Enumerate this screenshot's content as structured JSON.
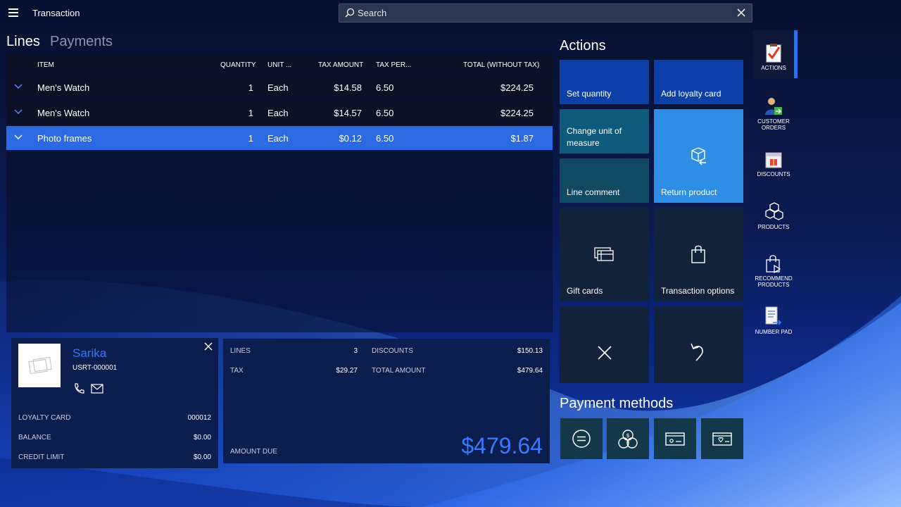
{
  "app": {
    "title": "Transaction"
  },
  "search": {
    "placeholder": "Search"
  },
  "tabs": [
    {
      "label": "Lines"
    },
    {
      "label": "Payments"
    }
  ],
  "grid": {
    "headers": {
      "item": "ITEM",
      "quantity": "QUANTITY",
      "unit": "UNIT ...",
      "tax_amount": "TAX AMOUNT",
      "tax_percent": "TAX PER...",
      "total": "TOTAL (WITHOUT TAX)"
    },
    "rows": [
      {
        "item": "Men's Watch",
        "quantity": "1",
        "unit": "Each",
        "tax_amount": "$14.58",
        "tax_percent": "6.50",
        "total": "$224.25"
      },
      {
        "item": "Men's Watch",
        "quantity": "1",
        "unit": "Each",
        "tax_amount": "$14.57",
        "tax_percent": "6.50",
        "total": "$224.25"
      },
      {
        "item": "Photo frames",
        "quantity": "1",
        "unit": "Each",
        "tax_amount": "$0.12",
        "tax_percent": "6.50",
        "total": "$1.87"
      }
    ],
    "selected_row": 2
  },
  "customer": {
    "name": "Sarika",
    "id": "USRT-000001",
    "loyalty_card_label": "LOYALTY CARD",
    "loyalty_card_value": "000012",
    "balance_label": "BALANCE",
    "balance_value": "$0.00",
    "credit_limit_label": "CREDIT LIMIT",
    "credit_limit_value": "$0.00"
  },
  "totals": {
    "lines_label": "LINES",
    "lines_value": "3",
    "discounts_label": "DISCOUNTS",
    "discounts_value": "$150.13",
    "tax_label": "TAX",
    "tax_value": "$29.27",
    "total_amount_label": "TOTAL AMOUNT",
    "total_amount_value": "$479.64",
    "amount_due_label": "AMOUNT DUE",
    "amount_due_value": "$479.64"
  },
  "actions": {
    "title": "Actions",
    "set_quantity": "Set quantity",
    "add_loyalty_card": "Add loyalty card",
    "change_unit_of_measure": "Change unit of measure",
    "line_comment": "Line comment",
    "return_product": "Return product",
    "gift_cards": "Gift cards",
    "transaction_options": "Transaction options"
  },
  "payment_methods": {
    "title": "Payment methods",
    "icons": [
      "cash-icon",
      "currency-icon",
      "card-icon",
      "loyalty-card-icon"
    ]
  },
  "right_nav": [
    {
      "label": "ACTIONS",
      "icon": "checklist-icon"
    },
    {
      "label": "CUSTOMER ORDERS",
      "icon": "customer-order-icon"
    },
    {
      "label": "DISCOUNTS",
      "icon": "discount-icon"
    },
    {
      "label": "PRODUCTS",
      "icon": "products-icon"
    },
    {
      "label": "RECOMMEND PRODUCTS",
      "icon": "recommend-icon"
    },
    {
      "label": "NUMBER PAD",
      "icon": "number-pad-icon"
    }
  ],
  "colors": {
    "accent": "#2b6ae2",
    "customer_name": "#3a78ff",
    "tile_blue": "#0d3fa8",
    "tile_teal": "#0e5a7a",
    "tile_dark": "#122238",
    "tile_bright": "#2e8ee6"
  }
}
